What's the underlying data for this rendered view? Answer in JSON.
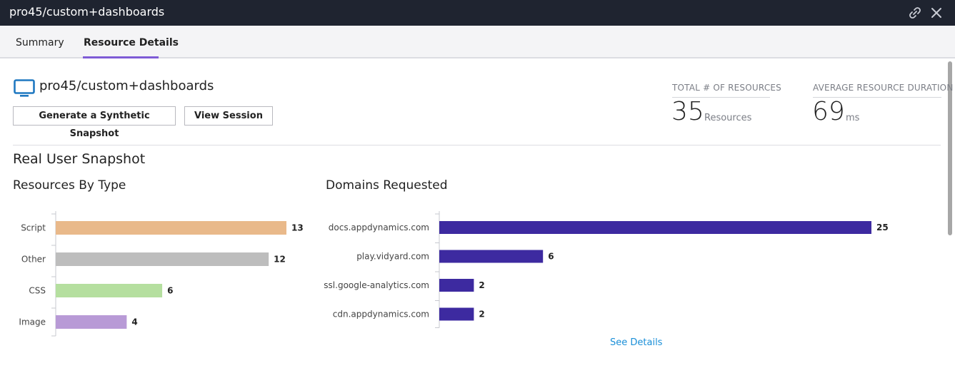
{
  "window": {
    "title": "pro45/custom+dashboards",
    "link_icon": "link-icon",
    "close_icon": "close-icon"
  },
  "tabs": [
    {
      "label": "Summary",
      "active": false
    },
    {
      "label": "Resource Details",
      "active": true
    }
  ],
  "header": {
    "icon": "monitor-icon",
    "page_name": "pro45/custom+dashboards",
    "buttons": {
      "synthetic": "Generate a Synthetic Snapshot",
      "session": "View Session"
    }
  },
  "metrics": {
    "total": {
      "label": "TOTAL # OF RESOURCES",
      "value": "35",
      "unit": "Resources"
    },
    "average": {
      "label": "AVERAGE RESOURCE DURATION",
      "value": "69",
      "unit": "ms"
    }
  },
  "section": {
    "title": "Real User Snapshot"
  },
  "see_details": "See Details",
  "colors": {
    "titlebar": "#1f2430",
    "tab_accent": "#7e5bd6",
    "link": "#1a8fd8",
    "monitor_icon": "#1f78c1"
  },
  "chart_data": [
    {
      "type": "bar",
      "orientation": "horizontal",
      "title": "Resources By Type",
      "categories": [
        "Script",
        "Other",
        "CSS",
        "Image"
      ],
      "values": [
        13,
        12,
        6,
        4
      ],
      "colors": [
        "#e9b98a",
        "#bdbdbd",
        "#b5df9f",
        "#b89ad6"
      ],
      "data_labels": true,
      "grid": false,
      "xlim": [
        0,
        13
      ]
    },
    {
      "type": "bar",
      "orientation": "horizontal",
      "title": "Domains Requested",
      "categories": [
        "docs.appdynamics.com",
        "play.vidyard.com",
        "ssl.google-analytics.com",
        "cdn.appdynamics.com"
      ],
      "values": [
        25,
        6,
        2,
        2
      ],
      "colors": [
        "#3d2aa0",
        "#3d2aa0",
        "#3d2aa0",
        "#3d2aa0"
      ],
      "data_labels": true,
      "grid": false,
      "xlim": [
        0,
        25
      ]
    }
  ]
}
